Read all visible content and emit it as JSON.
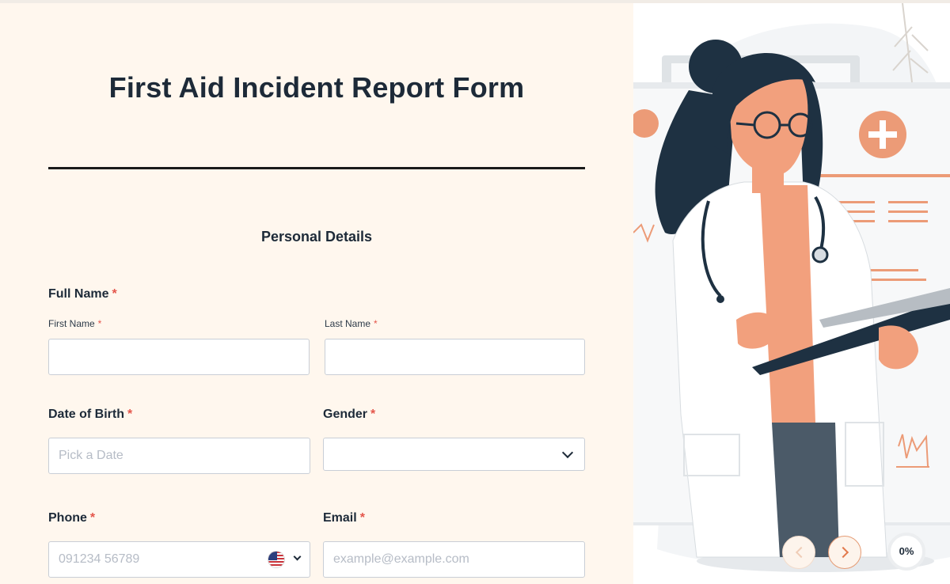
{
  "form": {
    "title": "First Aid Incident Report Form",
    "section": "Personal Details",
    "required_mark": "*",
    "full_name": {
      "label": "Full Name",
      "first_label": "First Name",
      "first_value": "",
      "last_label": "Last Name",
      "last_value": ""
    },
    "dob": {
      "label": "Date of Birth",
      "placeholder": "Pick a Date",
      "value": ""
    },
    "gender": {
      "label": "Gender",
      "value": ""
    },
    "phone": {
      "label": "Phone",
      "placeholder": "091234 56789",
      "value": "",
      "country_icon": "us-flag-icon"
    },
    "email": {
      "label": "Email",
      "placeholder": "example@example.com",
      "value": ""
    }
  },
  "nav": {
    "prev_icon": "chevron-left-icon",
    "next_icon": "chevron-right-icon"
  },
  "progress": {
    "value": 0,
    "label": "0%"
  },
  "colors": {
    "panel_bg": "#fff7ee",
    "accent": "#e59b74",
    "required": "#e4554a",
    "text": "#1d2a38"
  }
}
